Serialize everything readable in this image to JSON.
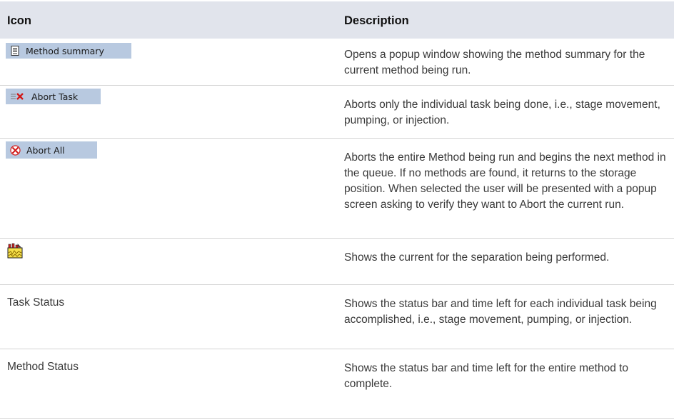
{
  "header": {
    "icon_col": "Icon",
    "description_col": "Description"
  },
  "rows": [
    {
      "icon_name": "method-summary-icon",
      "label": "Method summary",
      "description": "Opens a popup window showing the method summary for the current method being run."
    },
    {
      "icon_name": "abort-task-icon",
      "label": "Abort Task",
      "description": "Aborts only the individual task being done, i.e., stage movement, pumping, or injection."
    },
    {
      "icon_name": "abort-all-icon",
      "label": "Abort All",
      "description": "Aborts the entire Method being run and begins the next method in the queue. If no methods are found, it returns to the storage position. When selected the user will be presented with a popup screen asking to verify they want to Abort the current run."
    },
    {
      "icon_name": "current-graph-icon",
      "label": "",
      "description": "Shows the current for the separation being performed."
    },
    {
      "icon_name": "",
      "label": "Task Status",
      "description": "Shows the status bar and time left for each individual task being accomplished, i.e., stage movement, pumping, or injection."
    },
    {
      "icon_name": "",
      "label": "Method Status",
      "description": "Shows the status bar and time left for the entire method to complete."
    }
  ],
  "colors": {
    "header_bg": "#e1e4ec",
    "button_bg": "#b8c9e0",
    "abort_red": "#d11a1a",
    "divider": "#d4d4d4"
  }
}
